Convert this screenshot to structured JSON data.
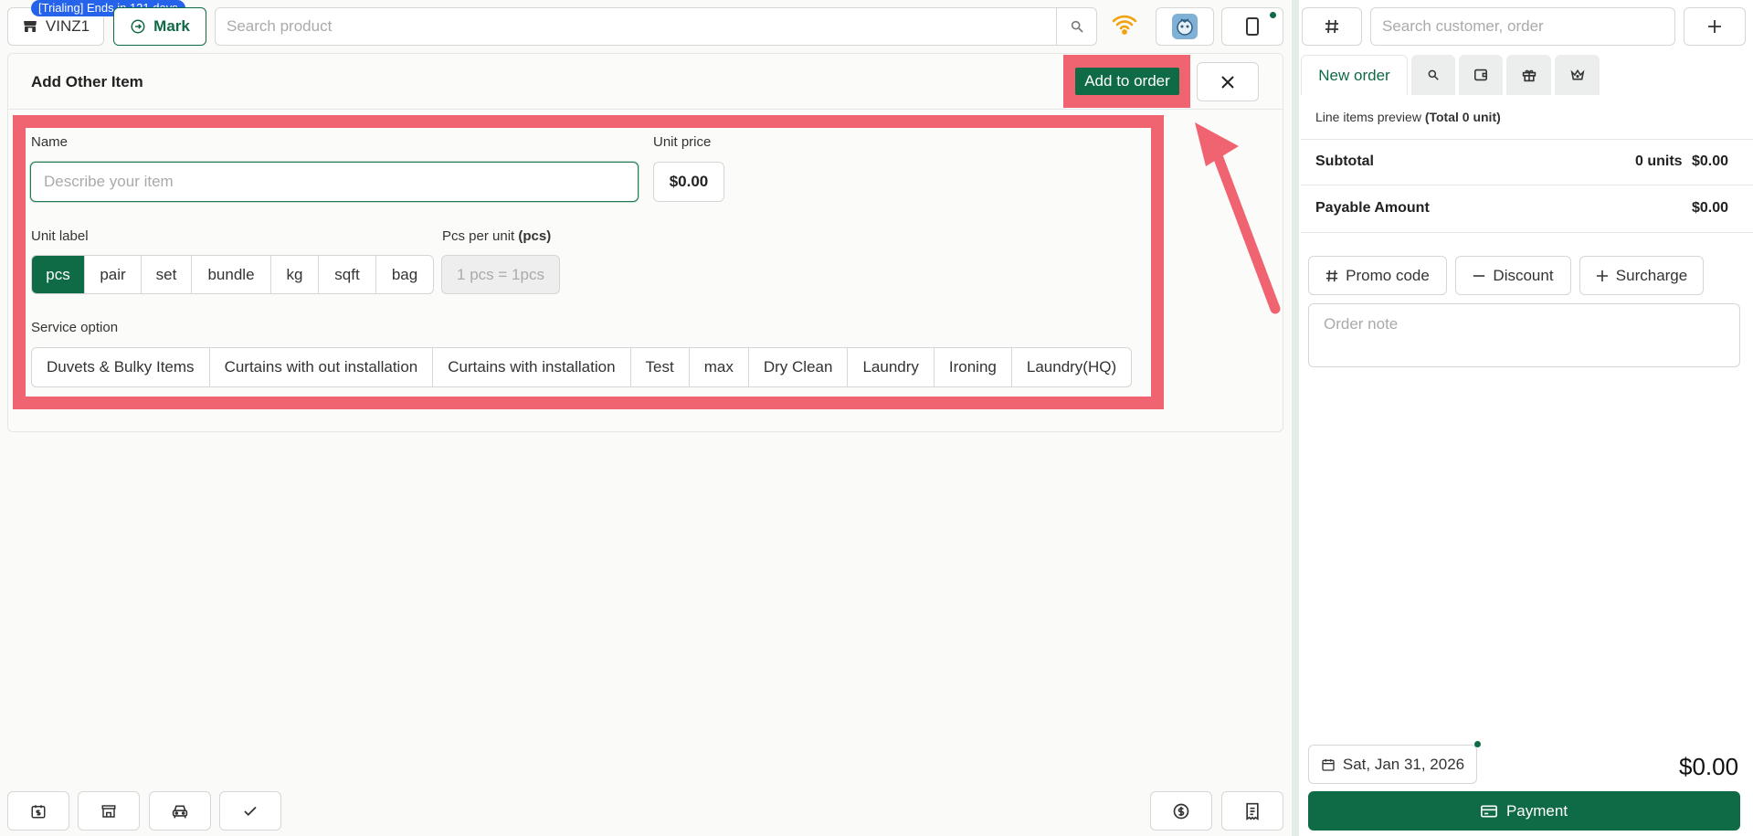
{
  "header": {
    "store_name": "VINZ1",
    "trial_badge": "[Trialing] Ends in 121 days",
    "mark_label": "Mark",
    "search_placeholder": "Search product"
  },
  "dialog": {
    "title": "Add Other Item",
    "add_to_order_label": "Add to order",
    "name_label": "Name",
    "name_placeholder": "Describe your item",
    "unit_price_label": "Unit price",
    "unit_price_value": "$0.00",
    "unit_label_label": "Unit label",
    "unit_options": [
      "pcs",
      "pair",
      "set",
      "bundle",
      "kg",
      "sqft",
      "bag"
    ],
    "selected_unit": "pcs",
    "pcs_per_unit_label": "Pcs per unit",
    "pcs_per_unit_unit": "(pcs)",
    "pcs_per_unit_value": "1 pcs = 1pcs",
    "service_option_label": "Service option",
    "service_options": [
      "Duvets & Bulky Items",
      "Curtains with out installation",
      "Curtains with installation",
      "Test",
      "max",
      "Dry Clean",
      "Laundry",
      "Ironing",
      "Laundry(HQ)"
    ]
  },
  "order_panel": {
    "customer_search_placeholder": "Search customer, order",
    "tabs": {
      "new_order": "New order"
    },
    "preview_label": "Line items preview",
    "preview_total": "(Total 0 unit)",
    "subtotal_label": "Subtotal",
    "subtotal_units": "0 units",
    "subtotal_amount": "$0.00",
    "payable_label": "Payable Amount",
    "payable_amount": "$0.00",
    "promo_label": "Promo code",
    "discount_label": "Discount",
    "surcharge_label": "Surcharge",
    "order_note_placeholder": "Order note",
    "date": "Sat, Jan 31, 2026",
    "total": "$0.00",
    "payment_label": "Payment"
  },
  "colors": {
    "brand_green": "#0f6b45",
    "highlight_red": "#f06370",
    "trial_blue": "#2563eb",
    "wifi_orange": "#f2a20c"
  }
}
